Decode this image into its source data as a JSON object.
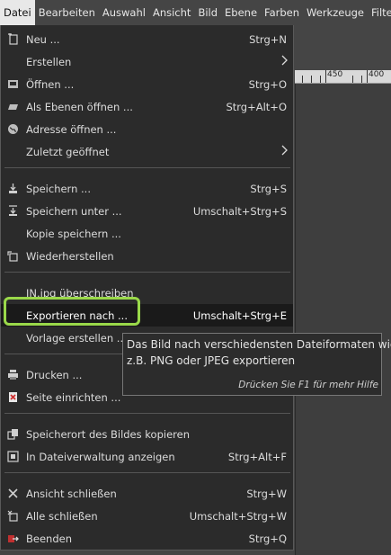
{
  "menubar": {
    "items": [
      "Datei",
      "Bearbeiten",
      "Auswahl",
      "Ansicht",
      "Bild",
      "Ebene",
      "Farben",
      "Werkzeuge",
      "Filte"
    ]
  },
  "ruler": {
    "labels": [
      "450",
      "400"
    ]
  },
  "file_menu": {
    "items": [
      {
        "label": "Neu ...",
        "shortcut": "Strg+N",
        "icon": "new-file-icon"
      },
      {
        "label": "Erstellen",
        "shortcut": "",
        "icon": "",
        "submenu": true
      },
      {
        "label": "Öffnen ...",
        "shortcut": "Strg+O",
        "icon": "open-icon"
      },
      {
        "label": "Als Ebenen öffnen ...",
        "shortcut": "Strg+Alt+O",
        "icon": "open-layers-icon"
      },
      {
        "label": "Adresse öffnen ...",
        "shortcut": "",
        "icon": "globe-icon"
      },
      {
        "label": "Zuletzt geöffnet",
        "shortcut": "",
        "icon": "",
        "submenu": true
      },
      {
        "label": "Speichern ...",
        "shortcut": "Strg+S",
        "icon": "save-icon"
      },
      {
        "label": "Speichern unter ...",
        "shortcut": "Umschalt+Strg+S",
        "icon": "save-as-icon"
      },
      {
        "label": "Kopie speichern ...",
        "shortcut": "",
        "icon": ""
      },
      {
        "label": "Wiederherstellen",
        "shortcut": "",
        "icon": "revert-icon"
      },
      {
        "label": "IN.jpg überschreiben",
        "shortcut": "",
        "icon": ""
      },
      {
        "label": "Exportieren nach ...",
        "shortcut": "Umschalt+Strg+E",
        "icon": ""
      },
      {
        "label": "Vorlage erstellen ...",
        "shortcut": "",
        "icon": ""
      },
      {
        "label": "Drucken ...",
        "shortcut": "",
        "icon": "print-icon"
      },
      {
        "label": "Seite einrichten ...",
        "shortcut": "",
        "icon": "page-setup-icon"
      },
      {
        "label": "Speicherort des Bildes kopieren",
        "shortcut": "",
        "icon": "copy-location-icon"
      },
      {
        "label": "In Dateiverwaltung anzeigen",
        "shortcut": "Strg+Alt+F",
        "icon": "file-manager-icon"
      },
      {
        "label": "Ansicht schließen",
        "shortcut": "Strg+W",
        "icon": "close-icon"
      },
      {
        "label": "Alle schließen",
        "shortcut": "Umschalt+Strg+W",
        "icon": "close-all-icon"
      },
      {
        "label": "Beenden",
        "shortcut": "Strg+Q",
        "icon": "quit-icon"
      }
    ]
  },
  "tooltip": {
    "line1": "Das Bild nach verschiedensten Dateiformaten wie",
    "line2": "z.B. PNG oder JPEG exportieren",
    "hint": "Drücken Sie F1 für mehr Hilfe"
  },
  "colors": {
    "menu_bg": "#2b2b2b",
    "highlight_bg": "#1a1a1a",
    "annotation_green": "#9ad94a"
  }
}
